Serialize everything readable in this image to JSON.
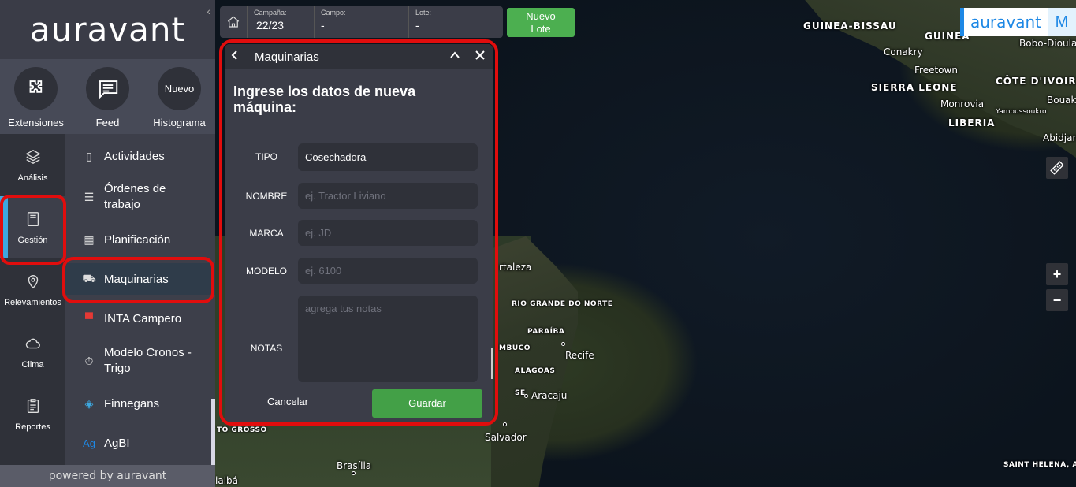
{
  "brand": {
    "logo": "auravant",
    "powered_by": "powered by auravant",
    "user_initial": "M"
  },
  "quick_actions": [
    {
      "label": "Extensiones",
      "icon": "puzzle-icon"
    },
    {
      "label": "Feed",
      "icon": "chat-icon"
    },
    {
      "label": "Histograma",
      "icon_text": "Nuevo"
    }
  ],
  "rail": [
    {
      "label": "Análisis",
      "icon": "layers-icon"
    },
    {
      "label": "Gestión",
      "icon": "clipboard-icon"
    },
    {
      "label": "Relevamientos",
      "icon": "map-pin-icon"
    },
    {
      "label": "Clima",
      "icon": "cloud-icon"
    },
    {
      "label": "Reportes",
      "icon": "report-icon"
    }
  ],
  "menu": [
    {
      "label": "Actividades"
    },
    {
      "label": "Órdenes de trabajo"
    },
    {
      "label": "Planificación"
    },
    {
      "label": "Maquinarias"
    },
    {
      "label": "INTA Campero"
    },
    {
      "label": "Modelo Cronos - Trigo"
    },
    {
      "label": "Finnegans"
    },
    {
      "label": "AgBI",
      "icon_text": "Ag"
    }
  ],
  "topbar": {
    "campana_label": "Campaña:",
    "campana_value": "22/23",
    "campo_label": "Campo:",
    "campo_value": "-",
    "lote_label": "Lote:",
    "lote_value": "-",
    "nuevo_lote": "Nuevo Lote"
  },
  "dialog": {
    "header": "Maquinarias",
    "title": "Ingrese los datos de nueva máquina:",
    "fields": {
      "tipo": {
        "label": "TIPO",
        "value": "Cosechadora"
      },
      "nombre": {
        "label": "NOMBRE",
        "placeholder": "ej. Tractor Liviano"
      },
      "marca": {
        "label": "MARCA",
        "placeholder": "ej. JD"
      },
      "modelo": {
        "label": "MODELO",
        "placeholder": "ej. 6100"
      },
      "notas": {
        "label": "NOTAS",
        "placeholder": "agrega tus notas"
      }
    },
    "cancel": "Cancelar",
    "save": "Guardar"
  },
  "map": {
    "labels": {
      "guinea_bissau": "GUINEA-BISSAU",
      "guinea": "GUINEA",
      "bobo": "Bobo-Dioulass",
      "conakry": "Conakry",
      "freetown": "Freetown",
      "sierra_leone": "SIERRA LEONE",
      "cote": "CÔTE D'IVOIRE",
      "monrovia": "Monrovia",
      "bouake": "Bouak",
      "yamoussoukro": "Yamoussoukro",
      "liberia": "LIBERIA",
      "abidjan": "Abidjan",
      "fortaleza": "rtaleza",
      "rio_grande": "RIO GRANDE DO NORTE",
      "paraiba": "PARAÍBA",
      "pernambuco": "MBUCO",
      "recife": "Recife",
      "alagoas": "ALAGOAS",
      "se": "SE",
      "aracaju": "Aracaju",
      "salvador": "Salvador",
      "mato_grosso": "TO GROSSO",
      "brasilia": "Brasília",
      "goiania": "iaibá",
      "saint_helena": "SAINT HELENA, ASCENSION AND TRISTAN DA CUNHA"
    },
    "zoom_in": "+",
    "zoom_out": "−"
  }
}
